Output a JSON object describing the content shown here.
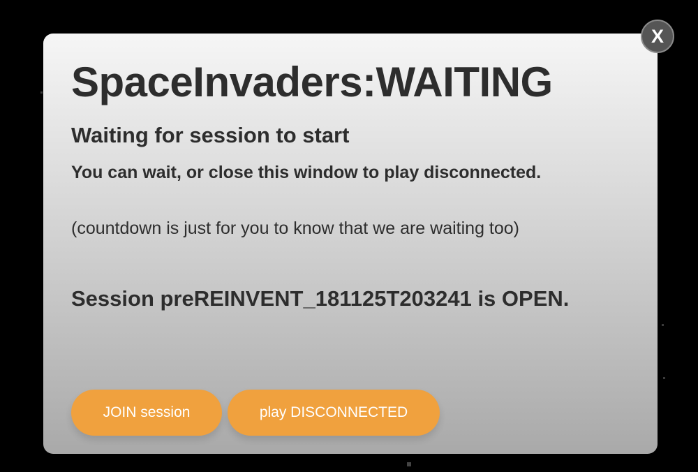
{
  "modal": {
    "title": "SpaceInvaders:WAITING",
    "subtitle": "Waiting for session to start",
    "instruction": "You can wait, or close this window to play disconnected.",
    "note": "(countdown is just for you to know that we are waiting too)",
    "session_status": "Session preREINVENT_181125T203241 is OPEN.",
    "buttons": {
      "join": "JOIN session",
      "disconnected": "play DISCONNECTED"
    },
    "close_label": "X"
  },
  "colors": {
    "background": "#000000",
    "button": "#f0a13e",
    "close_button": "#555555",
    "text": "#2d2d2d"
  },
  "icons": {
    "close": "close-icon"
  }
}
